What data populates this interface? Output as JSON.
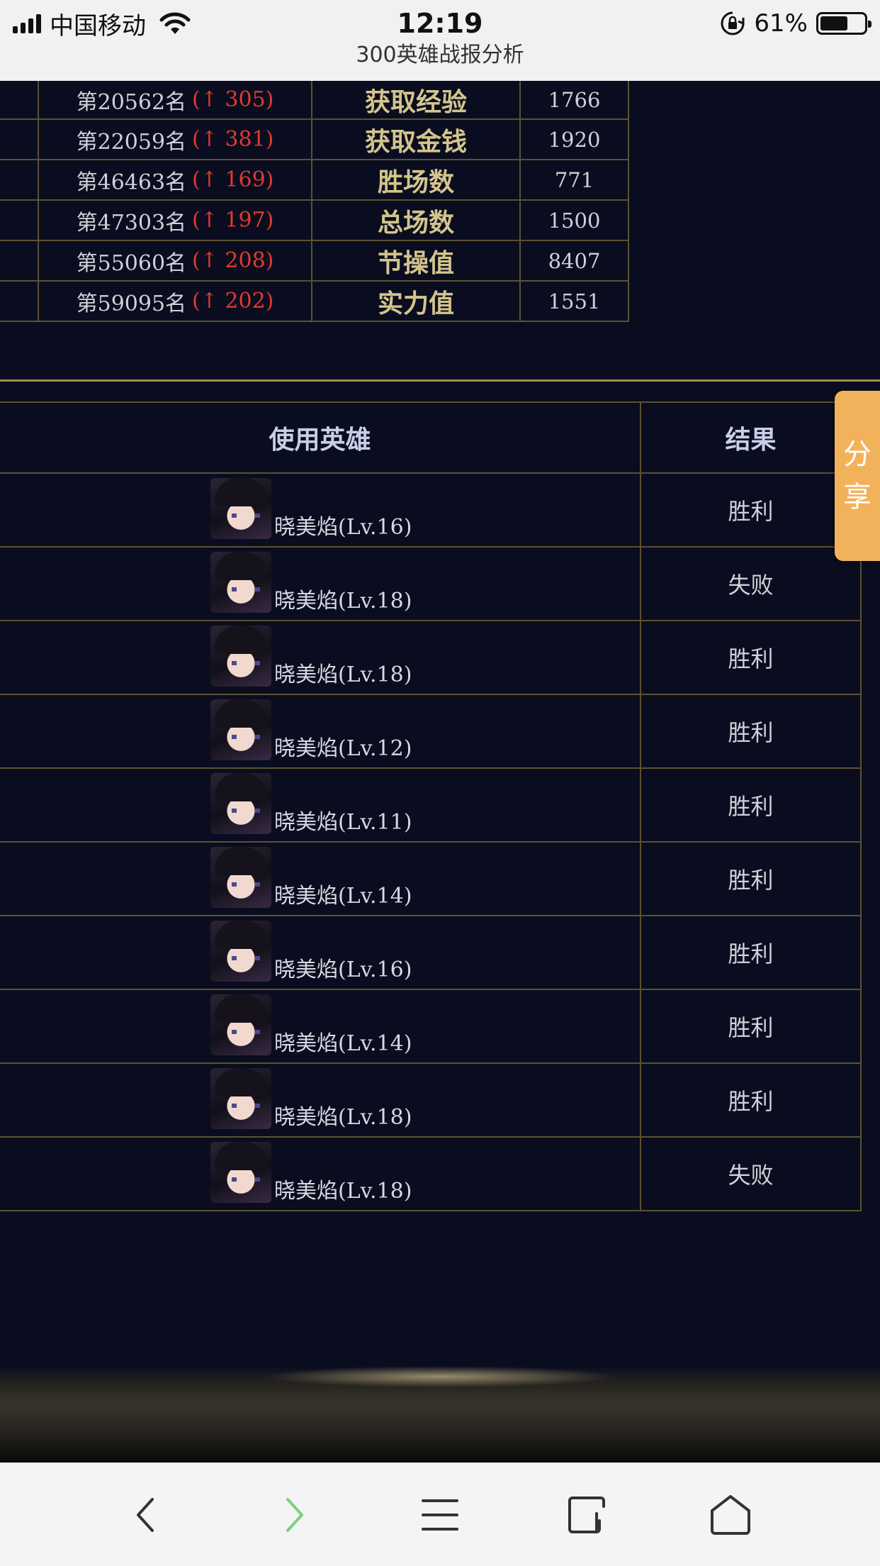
{
  "status_bar": {
    "carrier": "中国移动",
    "time": "12:19",
    "battery": "61%"
  },
  "page_title": "300英雄战报分析",
  "rankings": [
    {
      "rank": "第20562名",
      "change": "(↑ 305)",
      "label": "获取经验",
      "value": "1766"
    },
    {
      "rank": "第22059名",
      "change": "(↑ 381)",
      "label": "获取金钱",
      "value": "1920"
    },
    {
      "rank": "第46463名",
      "change": "(↑ 169)",
      "label": "胜场数",
      "value": "771"
    },
    {
      "rank": "第47303名",
      "change": "(↑ 197)",
      "label": "总场数",
      "value": "1500"
    },
    {
      "rank": "第55060名",
      "change": "(↑ 208)",
      "label": "节操值",
      "value": "8407"
    },
    {
      "rank": "第59095名",
      "change": "(↑ 202)",
      "label": "实力值",
      "value": "1551"
    }
  ],
  "matches": {
    "headers": {
      "hero": "使用英雄",
      "result": "结果"
    },
    "rows": [
      {
        "hero": "晓美焰(Lv.16)",
        "result": "胜利"
      },
      {
        "hero": "晓美焰(Lv.18)",
        "result": "失败"
      },
      {
        "hero": "晓美焰(Lv.18)",
        "result": "胜利"
      },
      {
        "hero": "晓美焰(Lv.12)",
        "result": "胜利"
      },
      {
        "hero": "晓美焰(Lv.11)",
        "result": "胜利"
      },
      {
        "hero": "晓美焰(Lv.14)",
        "result": "胜利"
      },
      {
        "hero": "晓美焰(Lv.16)",
        "result": "胜利"
      },
      {
        "hero": "晓美焰(Lv.14)",
        "result": "胜利"
      },
      {
        "hero": "晓美焰(Lv.18)",
        "result": "胜利"
      },
      {
        "hero": "晓美焰(Lv.18)",
        "result": "失败"
      }
    ]
  },
  "share": {
    "line1": "分",
    "line2": "享"
  },
  "toolbar": {
    "icons": [
      "back-icon",
      "forward-icon",
      "menu-icon",
      "tabs-icon",
      "home-icon"
    ],
    "forward_color": "#7ed07e"
  }
}
